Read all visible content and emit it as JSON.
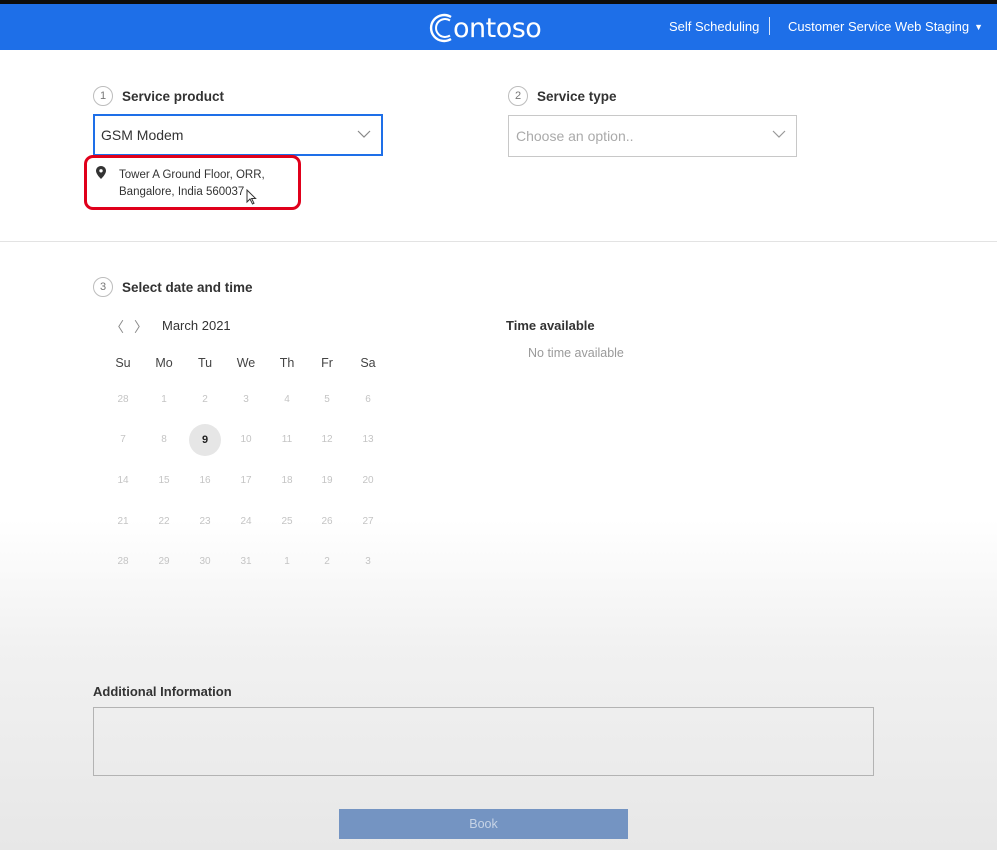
{
  "header": {
    "logo_text": "ontoso",
    "logo_initial": "C",
    "self_scheduling": "Self Scheduling",
    "environment": "Customer Service Web Staging",
    "bar_color": "#1e6fe8"
  },
  "step1": {
    "number": "1",
    "label": "Service product",
    "selected": "GSM Modem",
    "address_line1": "Tower A Ground Floor, ORR,",
    "address_line2": "Bangalore, India 560037",
    "highlight_color": "#e0001b"
  },
  "step2": {
    "number": "2",
    "label": "Service type",
    "placeholder": "Choose an option.."
  },
  "step3": {
    "number": "3",
    "label": "Select date and time",
    "month": "March 2021",
    "weekdays": [
      "Su",
      "Mo",
      "Tu",
      "We",
      "Th",
      "Fr",
      "Sa"
    ],
    "weeks": [
      [
        "28",
        "1",
        "2",
        "3",
        "4",
        "5",
        "6"
      ],
      [
        "7",
        "8",
        "9",
        "10",
        "11",
        "12",
        "13"
      ],
      [
        "14",
        "15",
        "16",
        "17",
        "18",
        "19",
        "20"
      ],
      [
        "21",
        "22",
        "23",
        "24",
        "25",
        "26",
        "27"
      ],
      [
        "28",
        "29",
        "30",
        "31",
        "1",
        "2",
        "3"
      ]
    ],
    "selected_day": "9",
    "time_title": "Time available",
    "time_status": "No time available"
  },
  "additional": {
    "label": "Additional Information",
    "value": ""
  },
  "book_label": "Book"
}
